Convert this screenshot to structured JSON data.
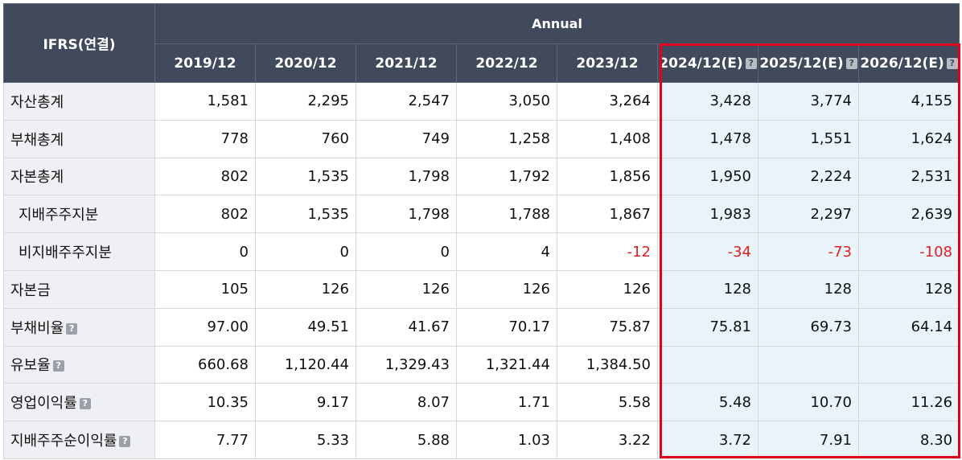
{
  "header": {
    "corner": "IFRS(연결)",
    "group": "Annual",
    "periods": [
      {
        "label": "2019/12",
        "estimate": false
      },
      {
        "label": "2020/12",
        "estimate": false
      },
      {
        "label": "2021/12",
        "estimate": false
      },
      {
        "label": "2022/12",
        "estimate": false
      },
      {
        "label": "2023/12",
        "estimate": false
      },
      {
        "label": "2024/12(E)",
        "estimate": true
      },
      {
        "label": "2025/12(E)",
        "estimate": true
      },
      {
        "label": "2026/12(E)",
        "estimate": true
      }
    ],
    "help_glyph": "?"
  },
  "rows": [
    {
      "label": "자산총계",
      "indent": false,
      "help": false,
      "values": [
        "1,581",
        "2,295",
        "2,547",
        "3,050",
        "3,264",
        "3,428",
        "3,774",
        "4,155"
      ]
    },
    {
      "label": "부채총계",
      "indent": false,
      "help": false,
      "values": [
        "778",
        "760",
        "749",
        "1,258",
        "1,408",
        "1,478",
        "1,551",
        "1,624"
      ]
    },
    {
      "label": "자본총계",
      "indent": false,
      "help": false,
      "values": [
        "802",
        "1,535",
        "1,798",
        "1,792",
        "1,856",
        "1,950",
        "2,224",
        "2,531"
      ]
    },
    {
      "label": "지배주주지분",
      "indent": true,
      "help": false,
      "values": [
        "802",
        "1,535",
        "1,798",
        "1,788",
        "1,867",
        "1,983",
        "2,297",
        "2,639"
      ]
    },
    {
      "label": "비지배주주지분",
      "indent": true,
      "help": false,
      "values": [
        "0",
        "0",
        "0",
        "4",
        "-12",
        "-34",
        "-73",
        "-108"
      ]
    },
    {
      "label": "자본금",
      "indent": false,
      "help": false,
      "values": [
        "105",
        "126",
        "126",
        "126",
        "126",
        "128",
        "128",
        "128"
      ]
    },
    {
      "label": "부채비율",
      "indent": false,
      "help": true,
      "values": [
        "97.00",
        "49.51",
        "41.67",
        "70.17",
        "75.87",
        "75.81",
        "69.73",
        "64.14"
      ]
    },
    {
      "label": "유보율",
      "indent": false,
      "help": true,
      "values": [
        "660.68",
        "1,120.44",
        "1,329.43",
        "1,321.44",
        "1,384.50",
        "",
        "",
        ""
      ]
    },
    {
      "label": "영업이익률",
      "indent": false,
      "help": true,
      "values": [
        "10.35",
        "9.17",
        "8.07",
        "1.71",
        "5.58",
        "5.48",
        "10.70",
        "11.26"
      ]
    },
    {
      "label": "지배주주순이익률",
      "indent": false,
      "help": true,
      "values": [
        "7.77",
        "5.33",
        "5.88",
        "1.03",
        "3.22",
        "3.72",
        "7.91",
        "8.30"
      ]
    }
  ],
  "colors": {
    "header_bg": "#404a5c",
    "estimate_bg": "#e8f4fa",
    "negative": "#e02020",
    "highlight_border": "#e3001b"
  }
}
